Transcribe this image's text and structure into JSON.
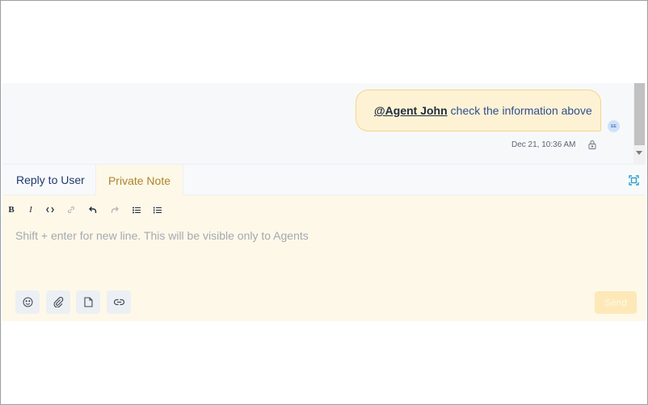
{
  "message": {
    "mention": "@Agent John",
    "text": "check the information above",
    "timestamp": "Dec 21, 10:36 AM",
    "avatar_initials": "EE",
    "lock_icon": "lock-icon"
  },
  "tabs": [
    {
      "label": "Reply to User",
      "active": false
    },
    {
      "label": "Private Note",
      "active": true
    }
  ],
  "toolbar": {
    "buttons": [
      "bold-icon",
      "italic-icon",
      "code-icon",
      "link-icon",
      "undo-icon",
      "redo-icon",
      "bullet-list-icon",
      "ordered-list-icon"
    ],
    "bold_glyph": "B",
    "italic_glyph": "I"
  },
  "editor": {
    "placeholder": "Shift + enter for new line. This will be visible only to Agents"
  },
  "actions": [
    "emoji-icon",
    "attachment-icon",
    "file-icon",
    "link-icon"
  ],
  "send_label": "Send",
  "colors": {
    "note_background": "#fef8e9",
    "bubble_background": "#fef2d5",
    "active_tab_text": "#a9862b",
    "send_disabled": "#fde9b8"
  }
}
